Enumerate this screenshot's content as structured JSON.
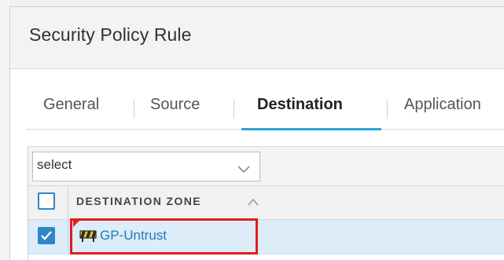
{
  "dialog": {
    "title": "Security Policy Rule"
  },
  "tabs": [
    {
      "label": "General",
      "active": false
    },
    {
      "label": "Source",
      "active": false
    },
    {
      "label": "Destination",
      "active": true
    },
    {
      "label": "Application",
      "active": false
    }
  ],
  "filter": {
    "select_value": "select",
    "chevron_icon": "chevron-down-icon"
  },
  "table": {
    "header": {
      "column": "DESTINATION ZONE",
      "sort_icon": "sort-ascending-icon",
      "select_all_checked": false
    },
    "rows": [
      {
        "zone": "GP-Untrust",
        "checked": true,
        "icon": "zone-icon",
        "highlighted": true
      }
    ]
  },
  "colors": {
    "accent": "#29a5d8",
    "checkbox": "#2f86c7",
    "link": "#1f79bd",
    "row_selected": "#dcecf8",
    "highlight": "#e51b1b"
  }
}
